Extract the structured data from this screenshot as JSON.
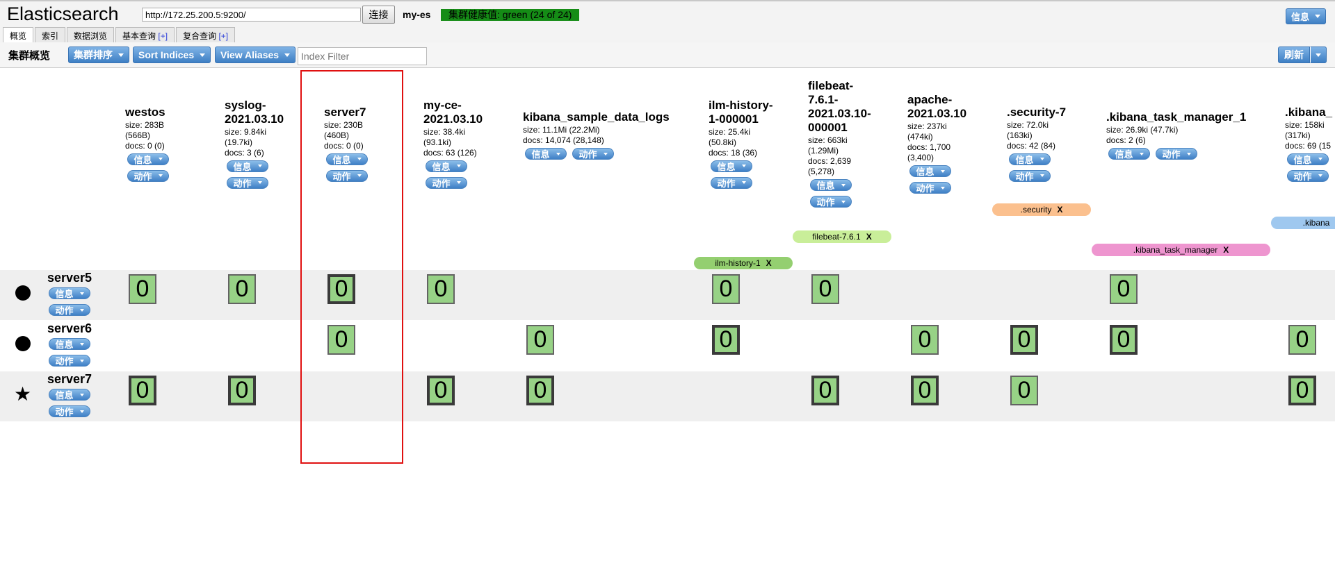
{
  "header": {
    "logo": "Elasticsearch",
    "url": "http://172.25.200.5:9200/",
    "connect_label": "连接",
    "cluster_name": "my-es",
    "health": "集群健康值: green (24 of 24)",
    "info_label": "信息"
  },
  "tabs": [
    {
      "label": "概览",
      "plus": ""
    },
    {
      "label": "索引",
      "plus": ""
    },
    {
      "label": "数据浏览",
      "plus": ""
    },
    {
      "label": "基本查询",
      "plus": "[+]"
    },
    {
      "label": "复合查询",
      "plus": "[+]"
    }
  ],
  "toolbar": {
    "title": "集群概览",
    "sort_cluster": "集群排序",
    "sort_indices": "Sort Indices",
    "view_aliases": "View Aliases",
    "index_filter_placeholder": "Index Filter",
    "refresh": "刷新"
  },
  "buttons": {
    "info": "信息",
    "action": "动作"
  },
  "indices": [
    {
      "name": "westos",
      "meta": [
        "size: 283B",
        "(566B)",
        "docs: 0 (0)"
      ]
    },
    {
      "name": "syslog-2021.03.10",
      "meta": [
        "size: 9.84ki",
        "(19.7ki)",
        "docs: 3 (6)"
      ]
    },
    {
      "name": "server7",
      "meta": [
        "size: 230B",
        "(460B)",
        "docs: 0 (0)"
      ]
    },
    {
      "name": "my-ce-2021.03.10",
      "meta": [
        "size: 38.4ki",
        "(93.1ki)",
        "docs: 63 (126)"
      ]
    },
    {
      "name": "kibana_sample_data_logs",
      "meta": [
        "size: 11.1Mi (22.2Mi)",
        "docs: 14,074 (28,148)"
      ]
    },
    {
      "name": "ilm-history-1-000001",
      "meta": [
        "size: 25.4ki",
        "(50.8ki)",
        "docs: 18 (36)"
      ]
    },
    {
      "name": "filebeat-7.6.1-2021.03.10-000001",
      "meta": [
        "size: 663ki",
        "(1.29Mi)",
        "docs: 2,639",
        "(5,278)"
      ]
    },
    {
      "name": "apache-2021.03.10",
      "meta": [
        "size: 237ki",
        "(474ki)",
        "docs: 1,700",
        "(3,400)"
      ]
    },
    {
      "name": ".security-7",
      "meta": [
        "size: 72.0ki",
        "(163ki)",
        "docs: 42 (84)"
      ]
    },
    {
      "name": ".kibana_task_manager_1",
      "meta": [
        "size: 26.9ki (47.7ki)",
        "docs: 2 (6)"
      ]
    },
    {
      "name": ".kibana_",
      "meta": [
        "size: 158ki",
        "(317ki)",
        "docs: 69 (15"
      ]
    }
  ],
  "aliases": [
    {
      "name": ".security",
      "color": "#fbc08e"
    },
    {
      "name": ".kibana",
      "color": "#9fc8ef"
    },
    {
      "name": "filebeat-7.6.1",
      "color": "#c9ee99"
    },
    {
      "name": ".kibana_task_manager",
      "color": "#ee95cf"
    },
    {
      "name": "ilm-history-1",
      "color": "#94cf70"
    }
  ],
  "nodes": [
    {
      "name": "server5",
      "marker": "dot"
    },
    {
      "name": "server6",
      "marker": "dot"
    },
    {
      "name": "server7",
      "marker": "star"
    }
  ],
  "shard_value": "0"
}
